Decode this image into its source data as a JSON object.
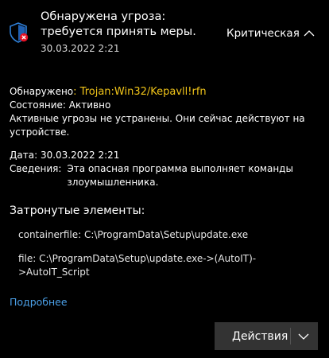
{
  "header": {
    "title": "Обнаружена угроза: требуется принять меры.",
    "date": "30.03.2022 2:21",
    "severity": "Критическая",
    "icon": "shield-threat-icon"
  },
  "details": {
    "detected_label": "Обнаружено",
    "threat_name": ": Trojan:Win32/Kepavll!rfn",
    "status_label": "Состояние:",
    "status_value": "Активно",
    "status_note": "Активные угрозы не устранены. Они сейчас действуют на устройстве.",
    "date_label": "Дата:",
    "date_value": "30.03.2022 2:21",
    "info_label": "Сведения:",
    "info_value": "Эта опасная программа выполняет команды злоумышленника."
  },
  "affected": {
    "heading": "Затронутые элементы:",
    "items": [
      "containerfile: C:\\ProgramData\\Setup\\update.exe",
      "file: C:\\ProgramData\\Setup\\update.exe->(AutoIT)->AutoIT_Script"
    ]
  },
  "more_link": "Подробнее",
  "actions_button": "Действия",
  "colors": {
    "background": "#000000",
    "threat_name": "#f0c419",
    "link": "#4ba0e8",
    "button_bg": "#333333",
    "shield": "#2f7fd6",
    "badge": "#e81123"
  }
}
